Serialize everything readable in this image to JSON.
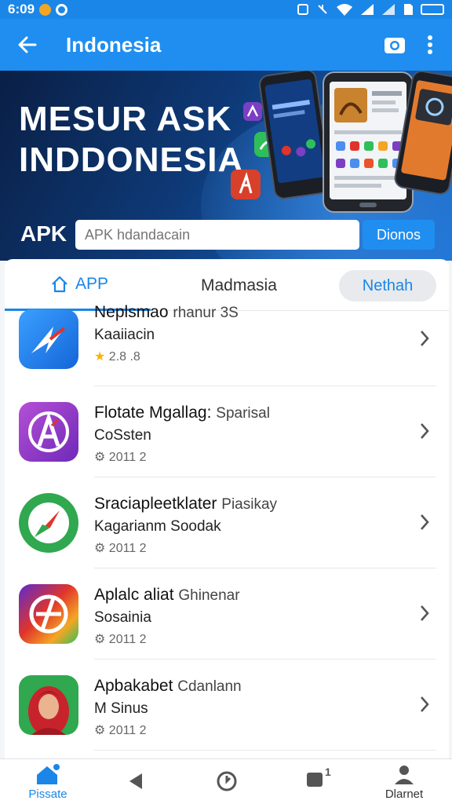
{
  "status_bar": {
    "time": "6:09",
    "icons": [
      "notification-dot",
      "record-icon",
      "nfc-icon",
      "mute-icon",
      "wifi-icon",
      "signal-icon",
      "signal-icon",
      "sd-card-icon",
      "battery-icon"
    ]
  },
  "app_bar": {
    "title": "Indonesia",
    "icons": [
      "back-arrow-icon",
      "camera-icon",
      "more-vert-icon"
    ]
  },
  "banner": {
    "title_line1": "MESUR ASK",
    "title_line2": "INDDONESIA",
    "apk_label": "APK",
    "search_placeholder": "APK hdandacain",
    "search_button": "Dionos"
  },
  "tabs": {
    "app": "APP",
    "middle": "Madmasia",
    "pill": "Nethah"
  },
  "apps": [
    {
      "name": "Neplsmao",
      "name_sub": "rhanur 3S",
      "developer": "Kaaiiacin",
      "meta": "2.8 .8",
      "meta_icon": "star-icon",
      "icon": "arrow-logo-icon"
    },
    {
      "name": "Flotate Mgallag:",
      "name_sub": "Sparisal",
      "developer": "CoSsten",
      "meta": "2011 2",
      "meta_icon": "gear-icon",
      "icon": "letter-a-icon"
    },
    {
      "name": "Sraciapleetklater",
      "name_sub": "Piasikay",
      "developer": "Kagarianm Soodak",
      "meta": "2011 2",
      "meta_icon": "gear-icon",
      "icon": "compass-icon"
    },
    {
      "name": "Aplalc aliat",
      "name_sub": "Ghinenar",
      "developer": "Sosainia",
      "meta": "2011 2",
      "meta_icon": "gear-icon",
      "icon": "rainbow-logo-icon"
    },
    {
      "name": "Apbakabet",
      "name_sub": "Cdanlann",
      "developer": "M Sinus",
      "meta": "2011 2",
      "meta_icon": "gear-icon",
      "icon": "portrait-icon"
    }
  ],
  "bottom_nav": [
    {
      "label": "Pissate",
      "icon": "home-icon",
      "active": true
    },
    {
      "label": "",
      "icon": "play-back-icon"
    },
    {
      "label": "",
      "icon": "clock-icon"
    },
    {
      "label": "",
      "icon": "square-badge-icon",
      "badge": "1"
    },
    {
      "label": "Dlarnet",
      "icon": "person-icon"
    }
  ],
  "colors": {
    "primary": "#1f8ef0",
    "banner_dark": "#0a1f45",
    "active_tab": "#1a86e8"
  }
}
